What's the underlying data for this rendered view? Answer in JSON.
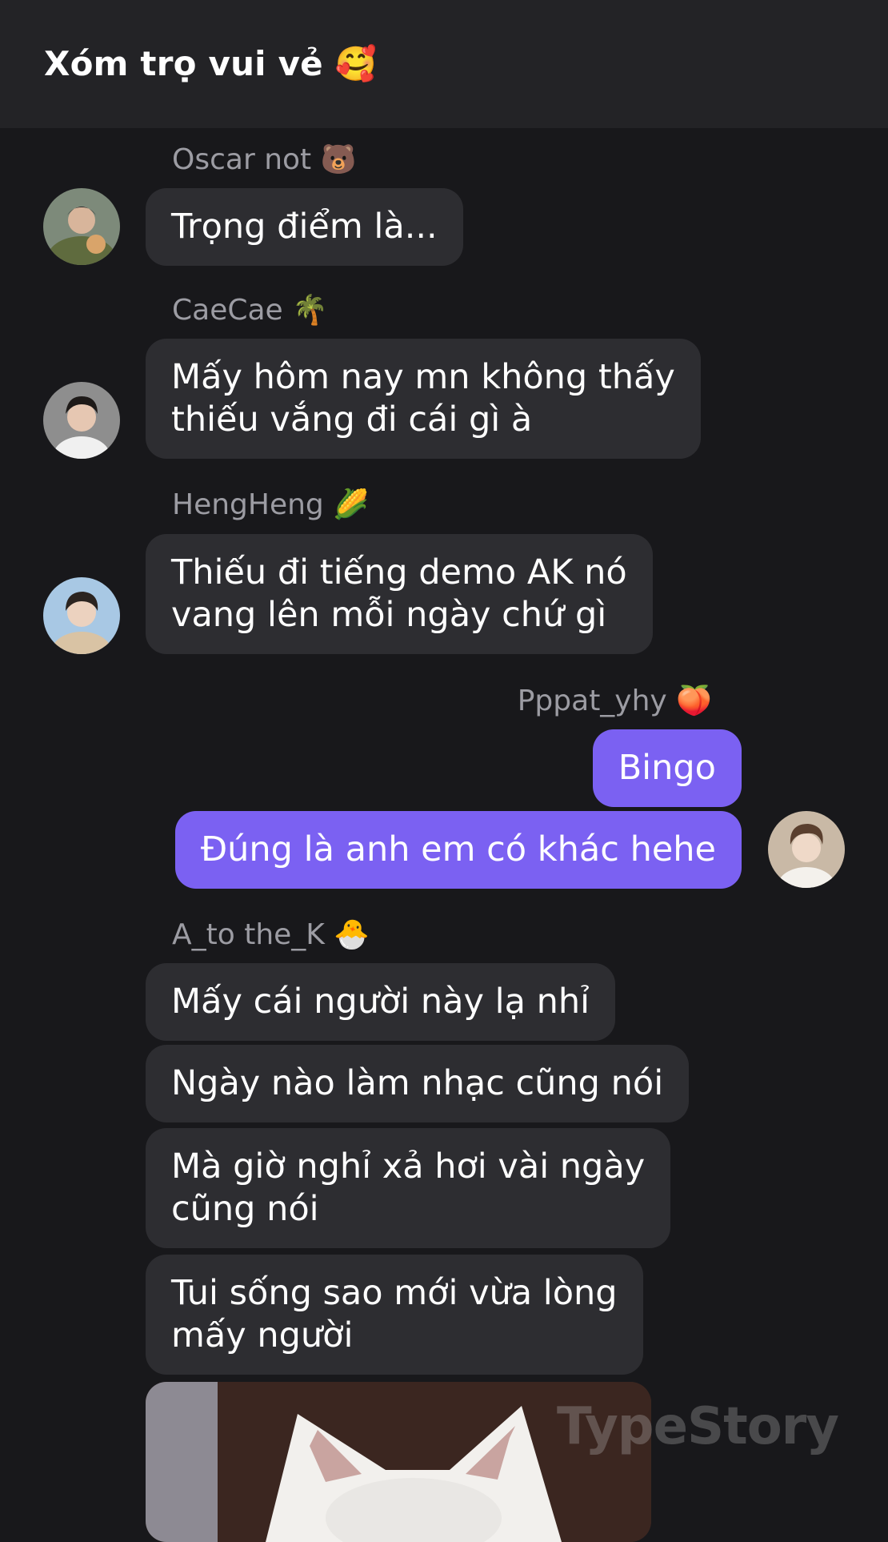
{
  "header": {
    "title": "Xóm trọ vui vẻ 🥰"
  },
  "messages": {
    "m1": {
      "sender": "Oscar not 🐻",
      "lines": [
        "Trọng điểm là..."
      ]
    },
    "m2": {
      "sender": "CaeCae 🌴",
      "lines": [
        "Mấy hôm nay mn không thấy",
        "thiếu vắng đi cái gì à"
      ]
    },
    "m3": {
      "sender": "HengHeng 🌽",
      "lines": [
        "Thiếu đi tiếng demo AK nó",
        "vang lên mỗi ngày chứ gì"
      ]
    },
    "m4": {
      "sender": "Pppat_yhy 🍑",
      "lines": [
        "Bingo"
      ]
    },
    "m5": {
      "lines": [
        "Đúng là anh em có khác hehe"
      ]
    },
    "m6": {
      "sender": "A_to the_K 🐣",
      "lines": [
        "Mấy cái người này lạ nhỉ"
      ]
    },
    "m7": {
      "lines": [
        "Ngày nào làm nhạc cũng nói"
      ]
    },
    "m8": {
      "lines": [
        "Mà giờ nghỉ xả hơi vài ngày",
        "cũng nói"
      ]
    },
    "m9": {
      "lines": [
        "Tui sống sao mới vừa lòng",
        "mấy người"
      ]
    }
  },
  "watermark": "TypeStory",
  "colors": {
    "background": "#18181b",
    "header": "#232326",
    "bubble_other": "#2d2d31",
    "bubble_me": "#7b61f2",
    "sender_name": "#9c9ca3"
  },
  "icons": {
    "avatars": [
      "user-avatar-oscar",
      "user-avatar-caecae",
      "user-avatar-hengheng",
      "user-avatar-self"
    ],
    "attachment": "cat-photo"
  }
}
